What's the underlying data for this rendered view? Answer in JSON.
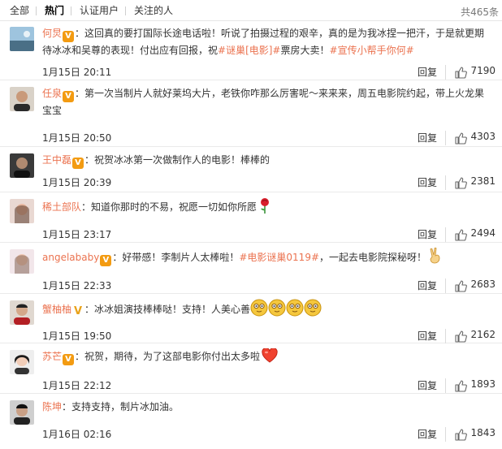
{
  "tabs": [
    {
      "label": "全部"
    },
    {
      "label": "热门"
    },
    {
      "label": "认证用户"
    },
    {
      "label": "关注的人"
    }
  ],
  "total": "共465条",
  "colors": {
    "username": "#eb7350",
    "topic": "#eb7350",
    "verified_badge": "#f39b12",
    "text": "#333333"
  },
  "comments": [
    {
      "user": "何炅",
      "badge": "V",
      "avatar_icon": "avatar-landscape",
      "text_a": "：这回真的要打国际长途电话啦！听说了拍摄过程的艰辛，真的是为我冰捏一把汗，于是就更期待冰冰和吴尊的表现！付出应有回报，祝",
      "tag_1": "#谜巢[电影]#",
      "text_b": "票房大卖！",
      "tag_2": "#宣传小帮手你何#",
      "time": "1月15日 20:11",
      "reply": "回复",
      "likes": "7190"
    },
    {
      "user": "任泉",
      "badge": "V",
      "avatar_icon": "avatar-man",
      "text_a": "：第一次当制片人就好莱坞大片，老铁你咋那么厉害呢～来来来，周五电影院约起，带上火龙果宝宝",
      "time": "1月15日 20:50",
      "reply": "回复",
      "likes": "4303"
    },
    {
      "user": "王中磊",
      "badge": "V",
      "avatar_icon": "avatar-man-dark",
      "text_a": "：祝贺冰冰第一次做制作人的电影！棒棒的",
      "time": "1月15日 20:39",
      "reply": "回复",
      "likes": "2381"
    },
    {
      "user": "稀土部队",
      "avatar_icon": "avatar-woman",
      "text_a": "：知道你那时的不易，祝愿一切如你所愿",
      "emoji": "rose-icon",
      "time": "1月15日 23:17",
      "reply": "回复",
      "likes": "2494"
    },
    {
      "user": "angelababy",
      "badge": "V",
      "avatar_icon": "avatar-woman-light",
      "text_a": "：好带感！李制片人太棒啦！",
      "tag_1": "#电影谜巢0119#",
      "text_b": "，一起去电影院探秘呀！",
      "emoji": "victory-hand-icon",
      "time": "1月15日 22:33",
      "reply": "回复",
      "likes": "2683"
    },
    {
      "user": "蟹柚柚",
      "badge": "V",
      "avatar_icon": "avatar-man",
      "text_a": "：冰冰姐演技棒棒哒！支持！人美心善",
      "emoji": "smiley-icon",
      "time": "1月15日 19:50",
      "reply": "回复",
      "likes": "2162"
    },
    {
      "user": "苏芒",
      "badge": "V",
      "avatar_icon": "avatar-woman",
      "text_a": "：祝贺，期待，为了这部电影你付出太多啦",
      "emoji": "heart-icon",
      "time": "1月15日 22:12",
      "reply": "回复",
      "likes": "1893"
    },
    {
      "user": "陈坤",
      "avatar_icon": "avatar-man-dark",
      "text_a": "：支持支持，制片冰加油。",
      "time": "1月16日 02:16",
      "reply": "回复",
      "likes": "1843"
    }
  ]
}
